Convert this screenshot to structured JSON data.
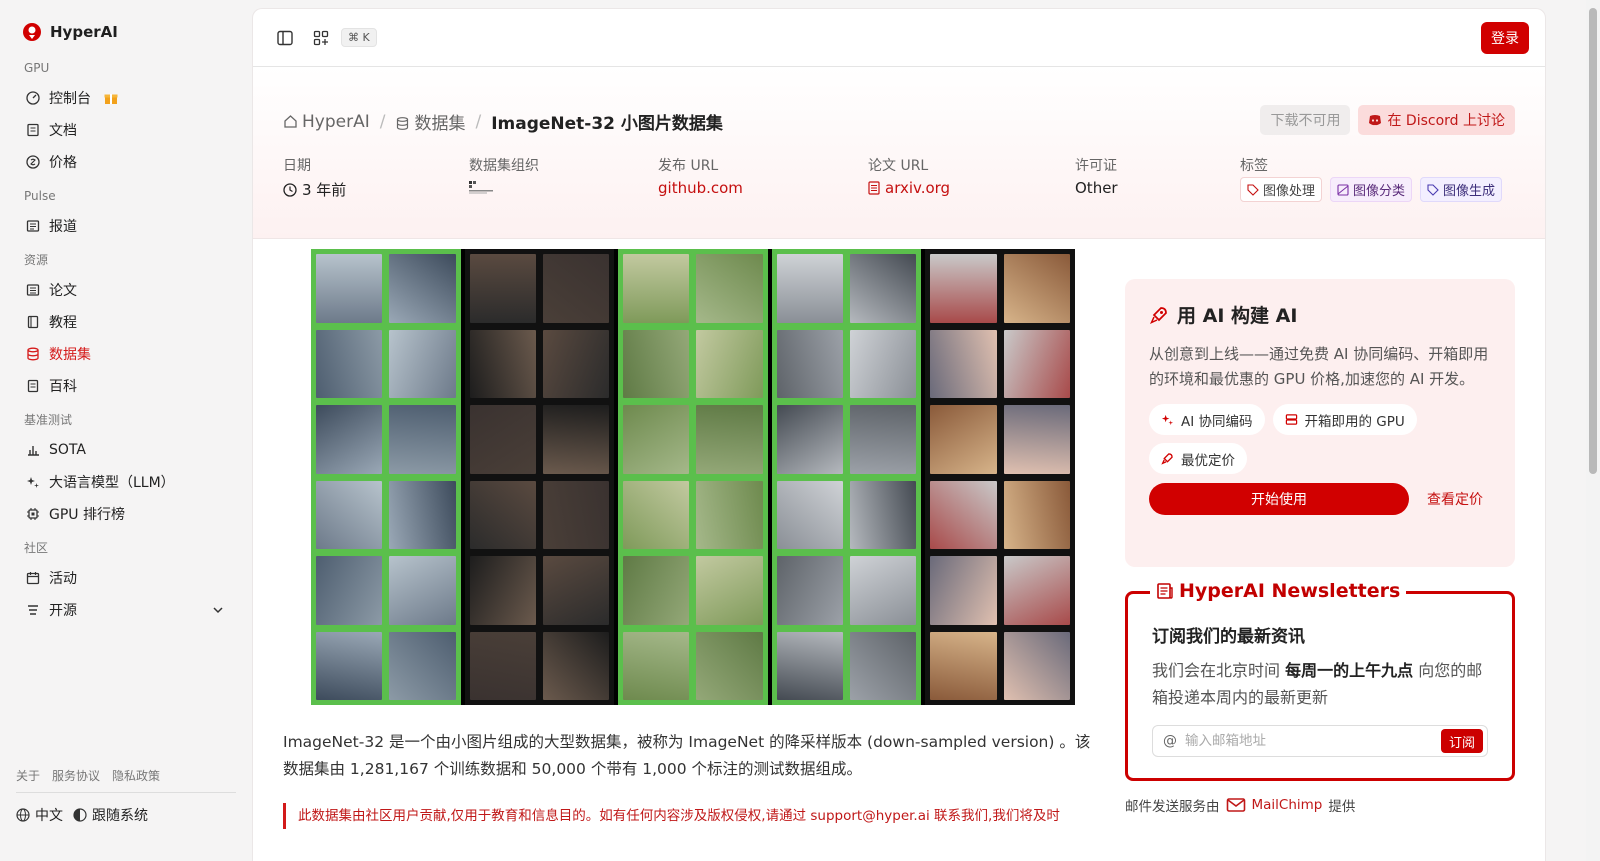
{
  "brand": {
    "name": "HyperAI",
    "accent": "#d10000"
  },
  "sidebar": {
    "sections": [
      {
        "title": "GPU",
        "items": [
          {
            "label": "控制台",
            "icon": "gauge-icon"
          },
          {
            "label": "文档",
            "icon": "document-icon"
          },
          {
            "label": "价格",
            "icon": "price-icon"
          }
        ]
      },
      {
        "title": "Pulse",
        "items": [
          {
            "label": "报道",
            "icon": "newspaper-icon"
          }
        ]
      },
      {
        "title": "资源",
        "items": [
          {
            "label": "论文",
            "icon": "paper-icon"
          },
          {
            "label": "教程",
            "icon": "book-icon"
          },
          {
            "label": "数据集",
            "icon": "database-icon",
            "active": true
          },
          {
            "label": "百科",
            "icon": "encyclopedia-icon"
          }
        ]
      },
      {
        "title": "基准测试",
        "items": [
          {
            "label": "SOTA",
            "icon": "bar-chart-icon"
          },
          {
            "label": "大语言模型（LLM）",
            "icon": "sparkles-icon"
          },
          {
            "label": "GPU 排行榜",
            "icon": "chip-icon"
          }
        ]
      },
      {
        "title": "社区",
        "items": [
          {
            "label": "活动",
            "icon": "calendar-icon"
          },
          {
            "label": "开源",
            "icon": "list-icon"
          }
        ]
      }
    ],
    "footer": {
      "links": [
        "关于",
        "服务协议",
        "隐私政策"
      ],
      "language": "中文",
      "theme": "跟随系统"
    }
  },
  "topbar": {
    "shortcut": "⌘ K",
    "login": "登录"
  },
  "header": {
    "breadcrumb": [
      "HyperAI",
      "数据集",
      "ImageNet-32 小图片数据集"
    ],
    "download": "下载不可用",
    "discord": "在 Discord 上讨论",
    "meta": {
      "date_label": "日期",
      "date_value": "3 年前",
      "org_label": "数据集组织",
      "url_label": "发布 URL",
      "url_value": "github.com",
      "paper_label": "论文 URL",
      "paper_value": "arxiv.org",
      "license_label": "许可证",
      "license_value": "Other",
      "tags_label": "标签",
      "tags": [
        "图像处理",
        "图像分类",
        "图像生成"
      ]
    }
  },
  "content": {
    "description": "ImageNet-32 是一个由小图片组成的大型数据集，被称为 ImageNet 的降采样版本 (down-sampled version) 。该数据集由 1,281,167 个训练数据和 50,000 个带有 1,000 个标注的测试数据组成。",
    "notice": "此数据集由社区用户贡献,仅用于教育和信息目的。如有任何内容涉及版权侵权,请通过 support@hyper.ai 联系我们,我们将及时"
  },
  "promo": {
    "title": "用 AI 构建 AI",
    "text": "从创意到上线——通过免费 AI 协同编码、开箱即用的环境和最优惠的 GPU 价格,加速您的 AI 开发。",
    "chips": [
      "AI 协同编码",
      "开箱即用的 GPU",
      "最优定价"
    ],
    "start": "开始使用",
    "pricing": "查看定价"
  },
  "newsletter": {
    "legend": "HyperAI Newsletters",
    "heading": "订阅我们的最新资讯",
    "text_before": "我们会在北京时间 ",
    "text_bold": "每周一的上午九点",
    "text_after": " 向您的邮箱投递本周内的最新更新",
    "placeholder": "输入邮箱地址",
    "subscribe": "订阅",
    "note_before": "邮件发送服务由",
    "note_brand": "MailChimp",
    "note_after": "提供"
  }
}
